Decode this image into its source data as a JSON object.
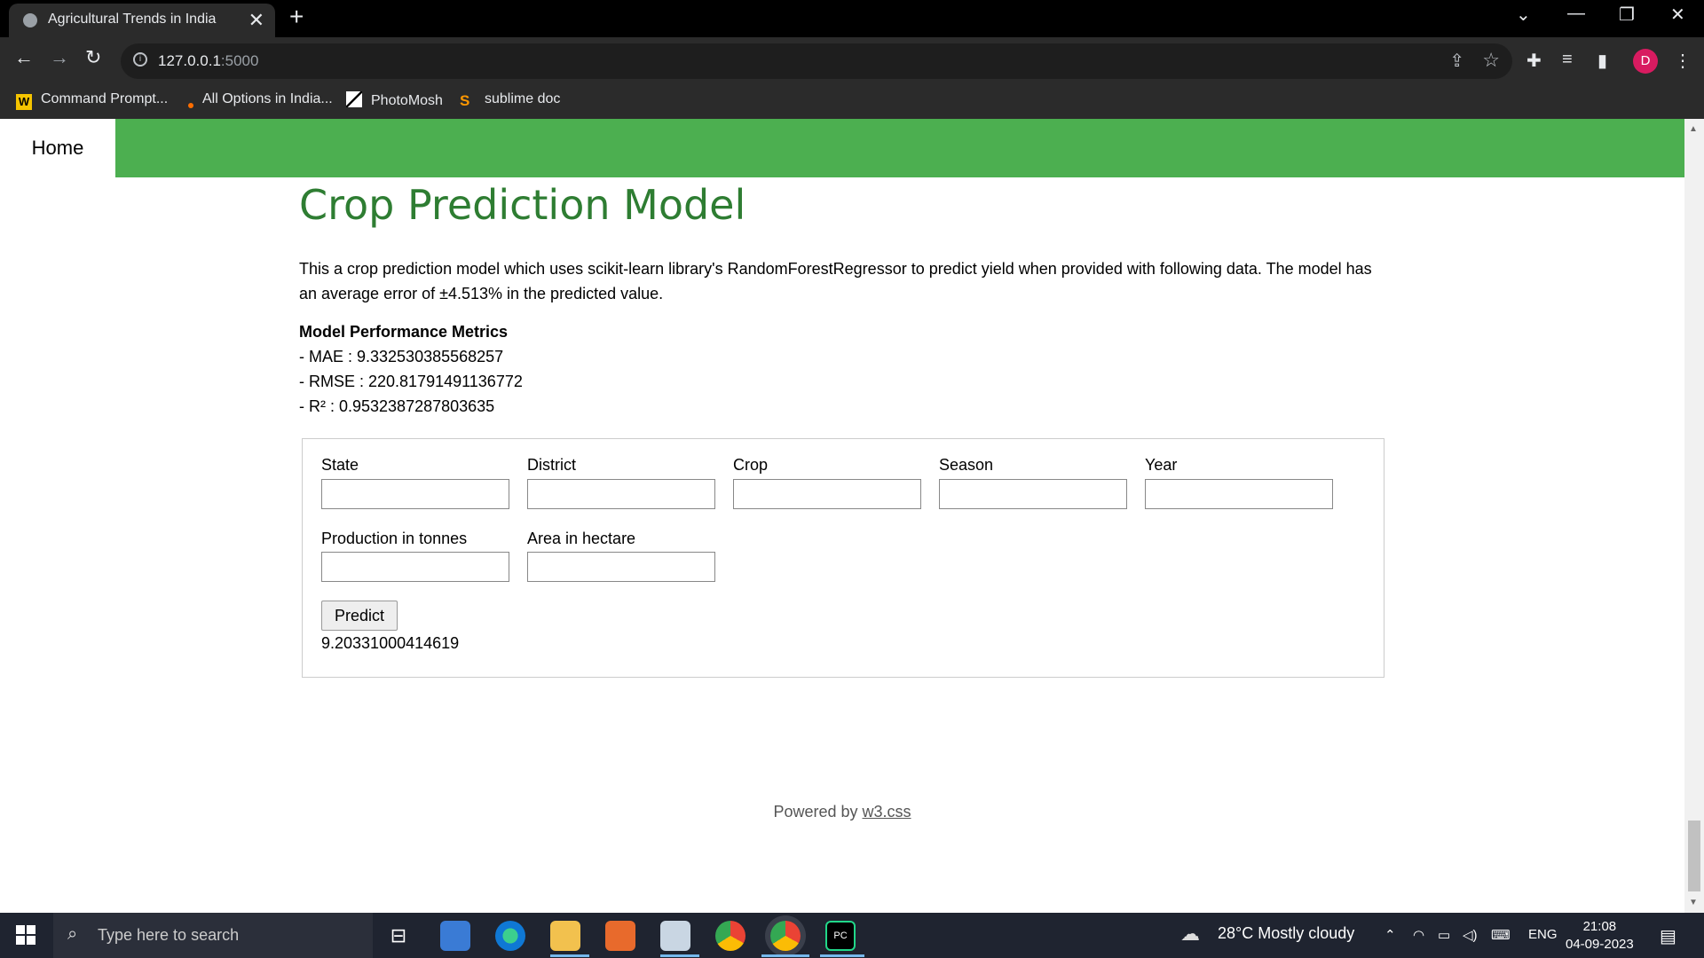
{
  "browser": {
    "tab_title": "Agricultural Trends in India",
    "new_tab": "+",
    "close_tab": "✕",
    "url_host": "127.0.0.1",
    "url_port": ":5000",
    "avatar_letter": "D",
    "bookmarks": [
      {
        "label": "Command Prompt...",
        "icon": "w-icon"
      },
      {
        "label": "All Options in India...",
        "icon": "dot-icon"
      },
      {
        "label": "PhotoMosh",
        "icon": "photomosh-icon"
      },
      {
        "label": "sublime doc",
        "icon": "sublime-icon"
      }
    ]
  },
  "nav": {
    "home_label": "Home"
  },
  "page": {
    "title": "Crop Prediction Model",
    "description": "This a crop prediction model which uses scikit-learn library's RandomForestRegressor to predict yield when provided with following data. The model has an average error of ±4.513% in the predicted value.",
    "metrics_heading": "Model Performance Metrics",
    "metrics": [
      "- MAE : 9.332530385568257",
      "- RMSE : 220.81791491136772",
      "- R² : 0.9532387287803635"
    ]
  },
  "form": {
    "state_label": "State",
    "district_label": "District",
    "crop_label": "Crop",
    "season_label": "Season",
    "year_label": "Year",
    "production_label": "Production in tonnes",
    "area_label": "Area in hectare",
    "predict_label": "Predict",
    "result": "9.20331000414619"
  },
  "footer": {
    "prefix": "Powered by ",
    "link": "w3.css"
  },
  "taskbar": {
    "search_placeholder": "Type here to search",
    "weather": "28°C  Mostly cloudy",
    "language": "ENG",
    "time": "21:08",
    "date": "04-09-2023"
  },
  "colors": {
    "navbar": "#4caf50",
    "title": "#2e7d32",
    "tabbar": "#000000"
  }
}
